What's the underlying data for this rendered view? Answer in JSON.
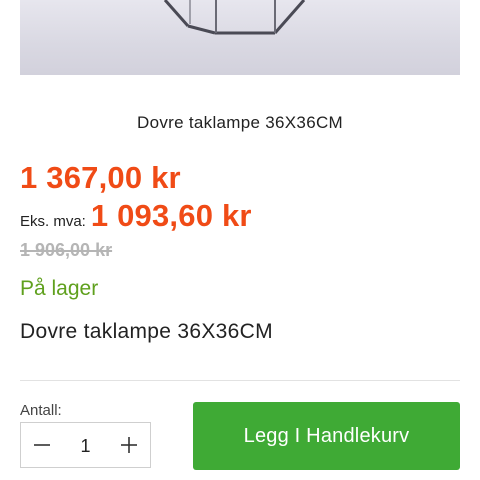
{
  "product": {
    "title": "Dovre taklampe 36X36CM",
    "price": "1 367,00 kr",
    "ex_vat_label": "Eks. mva:",
    "ex_vat_price": "1 093,60 kr",
    "old_price": "1 906,00 kr",
    "stock_status": "På lager",
    "image_icon": "product-lamp-image"
  },
  "purchase": {
    "quantity_label": "Antall:",
    "quantity_value": "1",
    "decrease_icon": "minus-icon",
    "increase_icon": "plus-icon",
    "add_to_cart_label": "Legg I Handlekurv"
  },
  "colors": {
    "price": "#f04b16",
    "stock": "#5fa01d",
    "button": "#3faa35",
    "old_price": "#b5b5b5"
  }
}
